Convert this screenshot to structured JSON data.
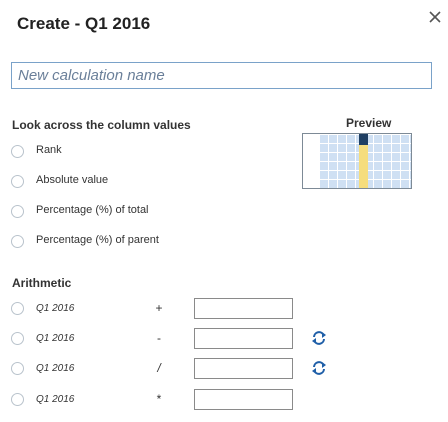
{
  "dialog": {
    "title": "Create - Q1 2016",
    "close_icon": "close-icon"
  },
  "name_input": {
    "placeholder": "New calculation name",
    "value": ""
  },
  "look_across": {
    "title": "Look across the column values",
    "options": [
      {
        "label": "Rank",
        "selected": false
      },
      {
        "label": "Absolute value",
        "selected": false
      },
      {
        "label": "Percentage (%) of total",
        "selected": false
      },
      {
        "label": "Percentage (%) of parent",
        "selected": false
      }
    ]
  },
  "preview": {
    "title": "Preview"
  },
  "arithmetic": {
    "title": "Arithmetic",
    "rows": [
      {
        "label": "Q1 2016",
        "operator": "+",
        "value": "",
        "swap_icon": ""
      },
      {
        "label": "Q1 2016",
        "operator": "-",
        "value": "",
        "swap_icon": "swap-icon"
      },
      {
        "label": "Q1 2016",
        "operator": "/",
        "value": "",
        "swap_icon": "swap-icon"
      },
      {
        "label": "Q1 2016",
        "operator": "*",
        "value": "",
        "swap_icon": ""
      }
    ]
  },
  "colors": {
    "accent": "#1f5fa8",
    "input_border": "#7aa2c9",
    "preview_cell": "#cfe0f3",
    "preview_highlight": "#f5dd7d",
    "preview_selected": "#1f3f63"
  }
}
